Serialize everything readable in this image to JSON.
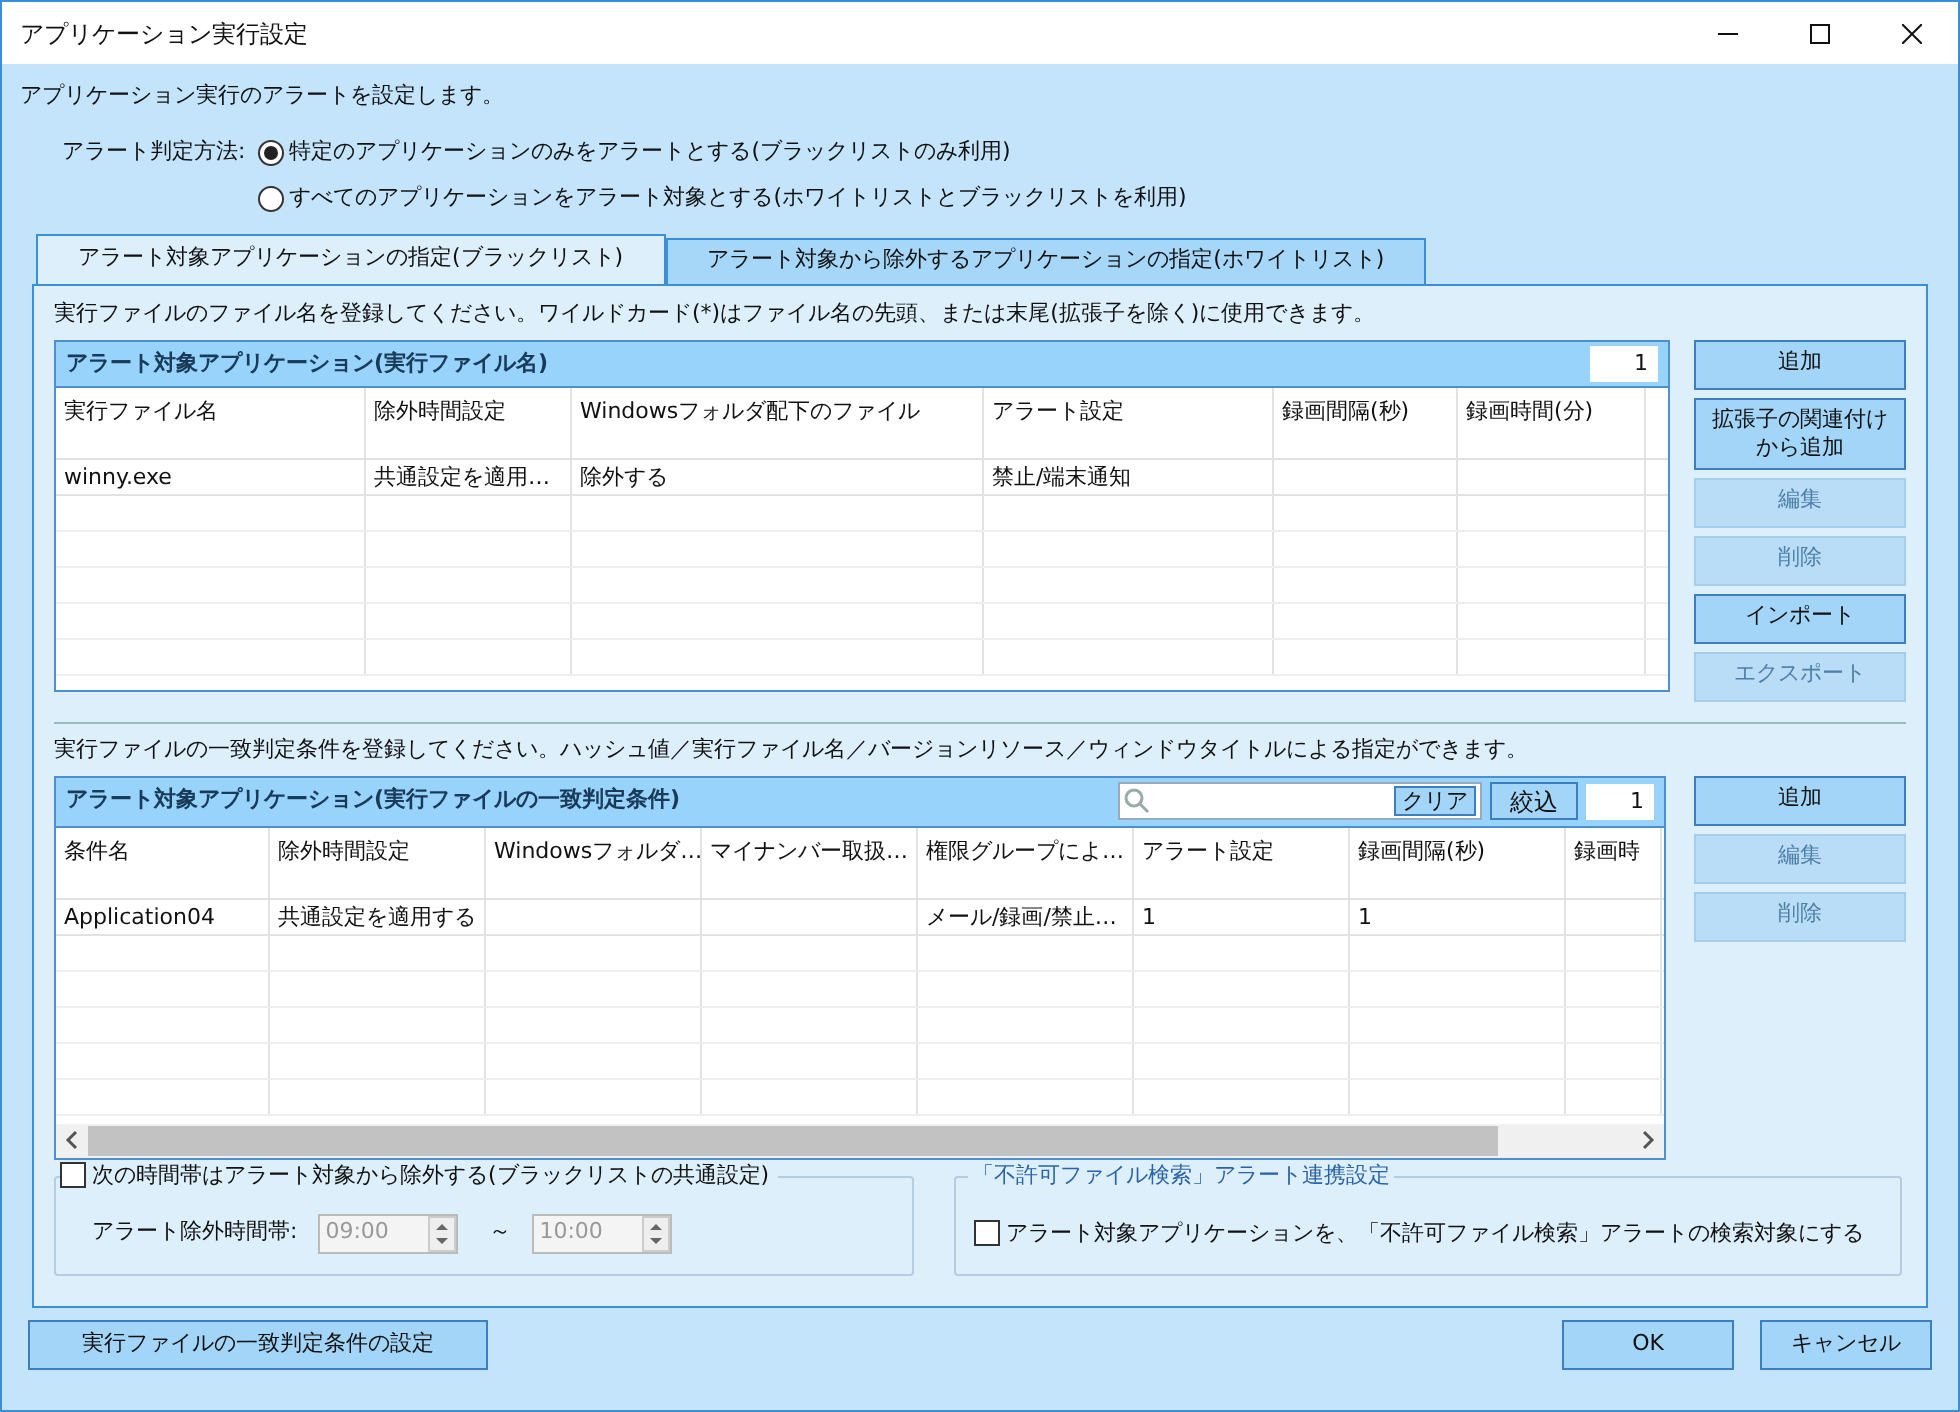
{
  "window": {
    "title": "アプリケーション実行設定"
  },
  "description": "アプリケーション実行のアラートを設定します。",
  "alert_method": {
    "label": "アラート判定方法:",
    "options": [
      {
        "label": "特定のアプリケーションのみをアラートとする(ブラックリストのみ利用)",
        "selected": true
      },
      {
        "label": "すべてのアプリケーションをアラート対象とする(ホワイトリストとブラックリストを利用)",
        "selected": false
      }
    ]
  },
  "tabs": [
    {
      "label": "アラート対象アプリケーションの指定(ブラックリスト)",
      "selected": true
    },
    {
      "label": "アラート対象から除外するアプリケーションの指定(ホワイトリスト)",
      "selected": false
    }
  ],
  "blacklist": {
    "note": "実行ファイルのファイル名を登録してください。ワイルドカード(*)はファイル名の先頭、または末尾(拡張子を除く)に使用できます。",
    "table": {
      "title": "アラート対象アプリケーション(実行ファイル名)",
      "count": "1",
      "columns": [
        "実行ファイル名",
        "除外時間設定",
        "Windowsフォルダ配下のファイル",
        "アラート設定",
        "録画間隔(秒)",
        "録画時間(分)"
      ],
      "rows": [
        [
          "winny.exe",
          "共通設定を適用…",
          "除外する",
          "禁止/端末通知",
          "",
          ""
        ]
      ]
    },
    "buttons": [
      {
        "label": "追加",
        "disabled": false
      },
      {
        "label": "拡張子の関連付け",
        "label_line_2": "から追加",
        "disabled": false
      },
      {
        "label": "編集",
        "disabled": true
      },
      {
        "label": "削除",
        "disabled": true
      },
      {
        "label": "インポート",
        "disabled": false
      },
      {
        "label": "エクスポート",
        "disabled": true
      }
    ]
  },
  "conditions": {
    "note": "実行ファイルの一致判定条件を登録してください。ハッシュ値／実行ファイル名／バージョンリソース／ウィンドウタイトルによる指定ができます。",
    "table": {
      "title": "アラート対象アプリケーション(実行ファイルの一致判定条件)",
      "clear_button": "クリア",
      "filter_button": "絞込",
      "count": "1",
      "columns": [
        "条件名",
        "除外時間設定",
        "Windowsフォルダ…",
        "マイナンバー取扱…",
        "権限グループによ…",
        "アラート設定",
        "録画間隔(秒)",
        "録画時"
      ],
      "rows": [
        [
          "Application04",
          "共通設定を適用する",
          "",
          "",
          "メール/録画/禁止…",
          "1",
          "1",
          ""
        ]
      ]
    },
    "buttons": [
      {
        "label": "追加",
        "disabled": false
      },
      {
        "label": "編集",
        "disabled": true
      },
      {
        "label": "削除",
        "disabled": true
      }
    ]
  },
  "time_exclusion": {
    "label": "次の時間帯はアラート対象から除外する(ブラックリストの共通設定)",
    "checked": false,
    "range_label": "アラート除外時間帯:",
    "from": "09:00",
    "separator": "～",
    "to": "10:00",
    "disabled": true
  },
  "linkage": {
    "title": "「不許可ファイル検索」アラート連携設定",
    "checkbox": {
      "label": "アラート対象アプリケーションを、「不許可ファイル検索」アラートの検索対象にする",
      "checked": false
    }
  },
  "footer": {
    "left_button": "実行ファイルの一致判定条件の設定",
    "ok_button": "OK",
    "cancel_button": "キャンセル"
  }
}
